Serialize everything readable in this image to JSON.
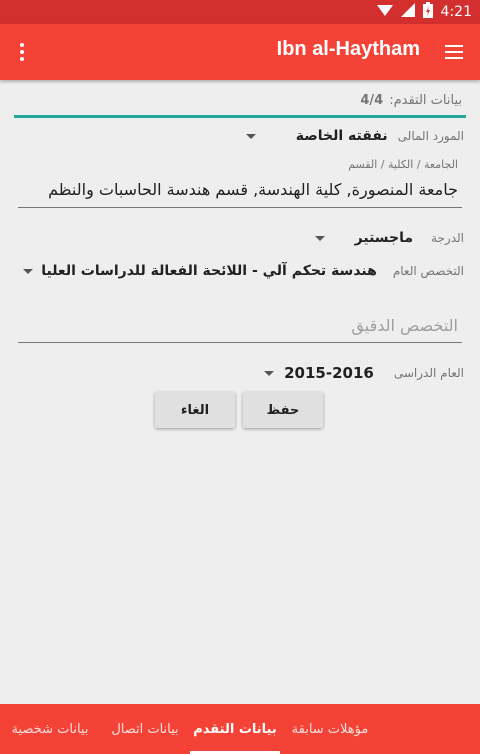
{
  "status_bar": {
    "time": "4:21"
  },
  "app_bar": {
    "title": "Ibn al-Haytham"
  },
  "progress": {
    "label": "بيانات التقدم:",
    "value": "4/4"
  },
  "form": {
    "funding": {
      "label": "المورد المالى",
      "value": "نفقته الخاصة"
    },
    "university": {
      "label": "الجامعة / الكلية / القسم",
      "value": "جامعة المنصورة, كلية الهندسة, قسم هندسة الحاسبات والنظم"
    },
    "degree": {
      "label": "الدرجة",
      "value": "ماجستير"
    },
    "general_spec": {
      "label": "التخصص العام",
      "value": "هندسة تحكم آلي - اللائحة الفعالة للدراسات العليا"
    },
    "precise_spec": {
      "placeholder": "التخصص الدقيق"
    },
    "academic_year": {
      "label": "العام الدراسى",
      "value": "2015-2016"
    }
  },
  "actions": {
    "save": "حفظ",
    "cancel": "الغاء"
  },
  "bottom_tabs": [
    "بيانات شخصية",
    "بيانات اتصال",
    "بيانات التقدم",
    "مؤهلات سابقة"
  ],
  "colors": {
    "primary": "#f44336",
    "status_bar": "#d32f2f",
    "accent": "#26a69a"
  }
}
